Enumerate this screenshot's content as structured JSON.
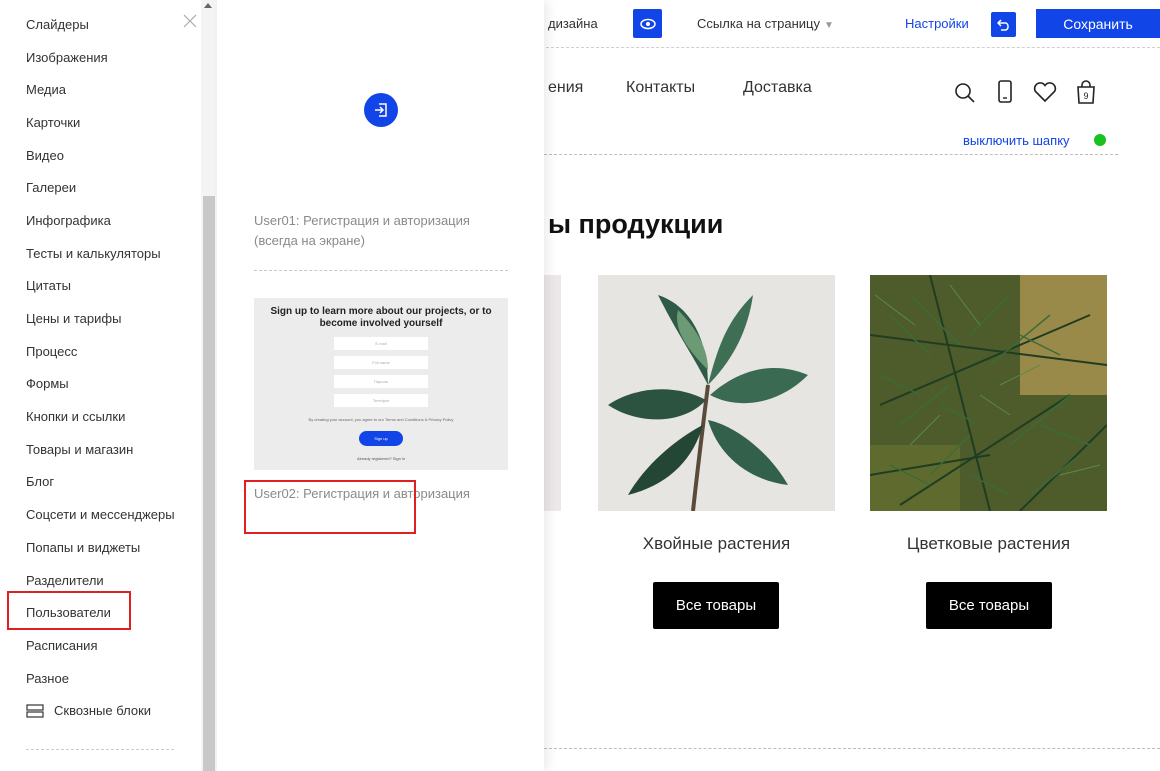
{
  "topbar": {
    "design_tail": "дизайна",
    "page_link": "Ссылка на страницу",
    "settings": "Настройки",
    "save": "Сохранить"
  },
  "header": {
    "nav": [
      "ения",
      "Контакты",
      "Доставка"
    ],
    "cart_count": "9",
    "toggle_header": "выключить шапку"
  },
  "content": {
    "section_title": "ы продукции",
    "cards": [
      {
        "title": "Хвойные растения",
        "button": "Все товары"
      },
      {
        "title": "Цветковые растения",
        "button": "Все товары"
      }
    ]
  },
  "sidebar": {
    "items": [
      "Слайдеры",
      "Изображения",
      "Медиа",
      "Карточки",
      "Видео",
      "Галереи",
      "Инфографика",
      "Тесты и калькуляторы",
      "Цитаты",
      "Цены и тарифы",
      "Процесс",
      "Формы",
      "Кнопки и ссылки",
      "Товары и магазин",
      "Блог",
      "Соцсети и мессенджеры",
      "Попапы и виджеты",
      "Разделители",
      "Пользователи",
      "Расписания",
      "Разное"
    ],
    "global_blocks": "Сквозные блоки"
  },
  "preview": {
    "block1_label": "User01: Регистрация и авторизация (всегда на экране)",
    "block2_label": "User02: Регистрация и авторизация",
    "thumb": {
      "title": "Sign up to learn more about our projects, or to become involved yourself",
      "fields": [
        "E-mail",
        "Full name",
        "Пароль",
        "Телефон"
      ],
      "terms": "By creating your account, you agree to our Terms and Conditions & Privacy Policy",
      "button": "Sign up",
      "already": "Already registered? Sign in"
    }
  },
  "colors": {
    "accent": "#1245e8",
    "highlight": "#e02020",
    "status_green": "#19c21e"
  }
}
